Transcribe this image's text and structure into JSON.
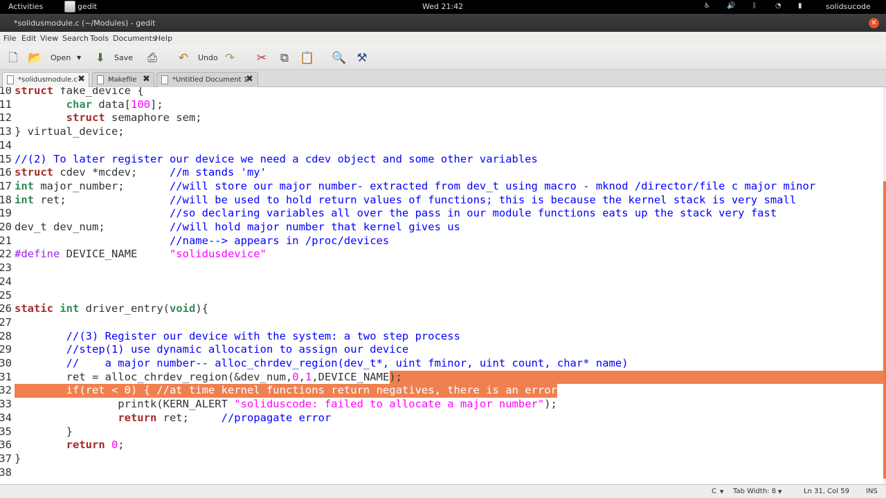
{
  "topbar": {
    "activities": "Activities",
    "app_name": "gedit",
    "clock": "Wed 21:42",
    "user": "solidsucode",
    "icons": [
      "accessibility-icon",
      "volume-icon",
      "bluetooth-icon",
      "wifi-icon",
      "battery-icon"
    ]
  },
  "window": {
    "title": "*solidusmodule.c (~/Modules) - gedit"
  },
  "menu": [
    "File",
    "Edit",
    "View",
    "Search",
    "Tools",
    "Documents",
    "Help"
  ],
  "toolbar": {
    "open_label": "Open",
    "save_label": "Save",
    "undo_label": "Undo"
  },
  "tabs": [
    {
      "label": "*solidusmodule.c"
    },
    {
      "label": "Makefile"
    },
    {
      "label": "*Untitled Document 1"
    }
  ],
  "editor": {
    "lines": [
      {
        "n": "10",
        "text": "struct fake_device {"
      },
      {
        "n": "11",
        "text": "        char data[100];"
      },
      {
        "n": "12",
        "text": "        struct semaphore sem;"
      },
      {
        "n": "13",
        "text": "} virtual_device;"
      },
      {
        "n": "14",
        "text": ""
      },
      {
        "n": "15",
        "text": "//(2) To later register our device we need a cdev object and some other variables"
      },
      {
        "n": "16",
        "text": "struct cdev *mcdev;     //m stands 'my'"
      },
      {
        "n": "17",
        "text": "int major_number;       //will store our major number- extracted from dev_t using macro - mknod /director/file c major minor"
      },
      {
        "n": "18",
        "text": "int ret;                //will be used to hold return values of functions; this is because the kernel stack is very small"
      },
      {
        "n": "19",
        "text": "                        //so declaring variables all over the pass in our module functions eats up the stack very fast"
      },
      {
        "n": "20",
        "text": "dev_t dev_num;          //will hold major number that kernel gives us"
      },
      {
        "n": "21",
        "text": "                        //name--> appears in /proc/devices"
      },
      {
        "n": "22",
        "text": "#define DEVICE_NAME     \"solidusdevice\""
      },
      {
        "n": "23",
        "text": ""
      },
      {
        "n": "24",
        "text": ""
      },
      {
        "n": "25",
        "text": ""
      },
      {
        "n": "26",
        "text": "static int driver_entry(void){"
      },
      {
        "n": "27",
        "text": ""
      },
      {
        "n": "28",
        "text": "        //(3) Register our device with the system: a two step process"
      },
      {
        "n": "29",
        "text": "        //step(1) use dynamic allocation to assign our device"
      },
      {
        "n": "30",
        "text": "        //    a major number-- alloc_chrdev_region(dev_t*, uint fminor, uint count, char* name)"
      },
      {
        "n": "31",
        "text": "        ret = alloc_chrdev_region(&dev_num,0,1,DEVICE_NAME);"
      },
      {
        "n": "32",
        "text": "        if(ret < 0) { //at time kernel functions return negatives, there is an error"
      },
      {
        "n": "33",
        "text": "                printk(KERN_ALERT \"soliduscode: failed to allocate a major number\");"
      },
      {
        "n": "34",
        "text": "                return ret;     //propagate error"
      },
      {
        "n": "35",
        "text": "        }"
      },
      {
        "n": "36",
        "text": "        return 0;"
      },
      {
        "n": "37",
        "text": "}"
      },
      {
        "n": "38",
        "text": ""
      }
    ]
  },
  "statusbar": {
    "language": "C",
    "tab_width": "Tab Width: 8",
    "position": "Ln 31, Col 59",
    "mode": "INS"
  },
  "colors": {
    "current_line": "#f08050",
    "comment": "#0000ff",
    "keyword": "#a52a2a",
    "number": "#ff00ff"
  }
}
